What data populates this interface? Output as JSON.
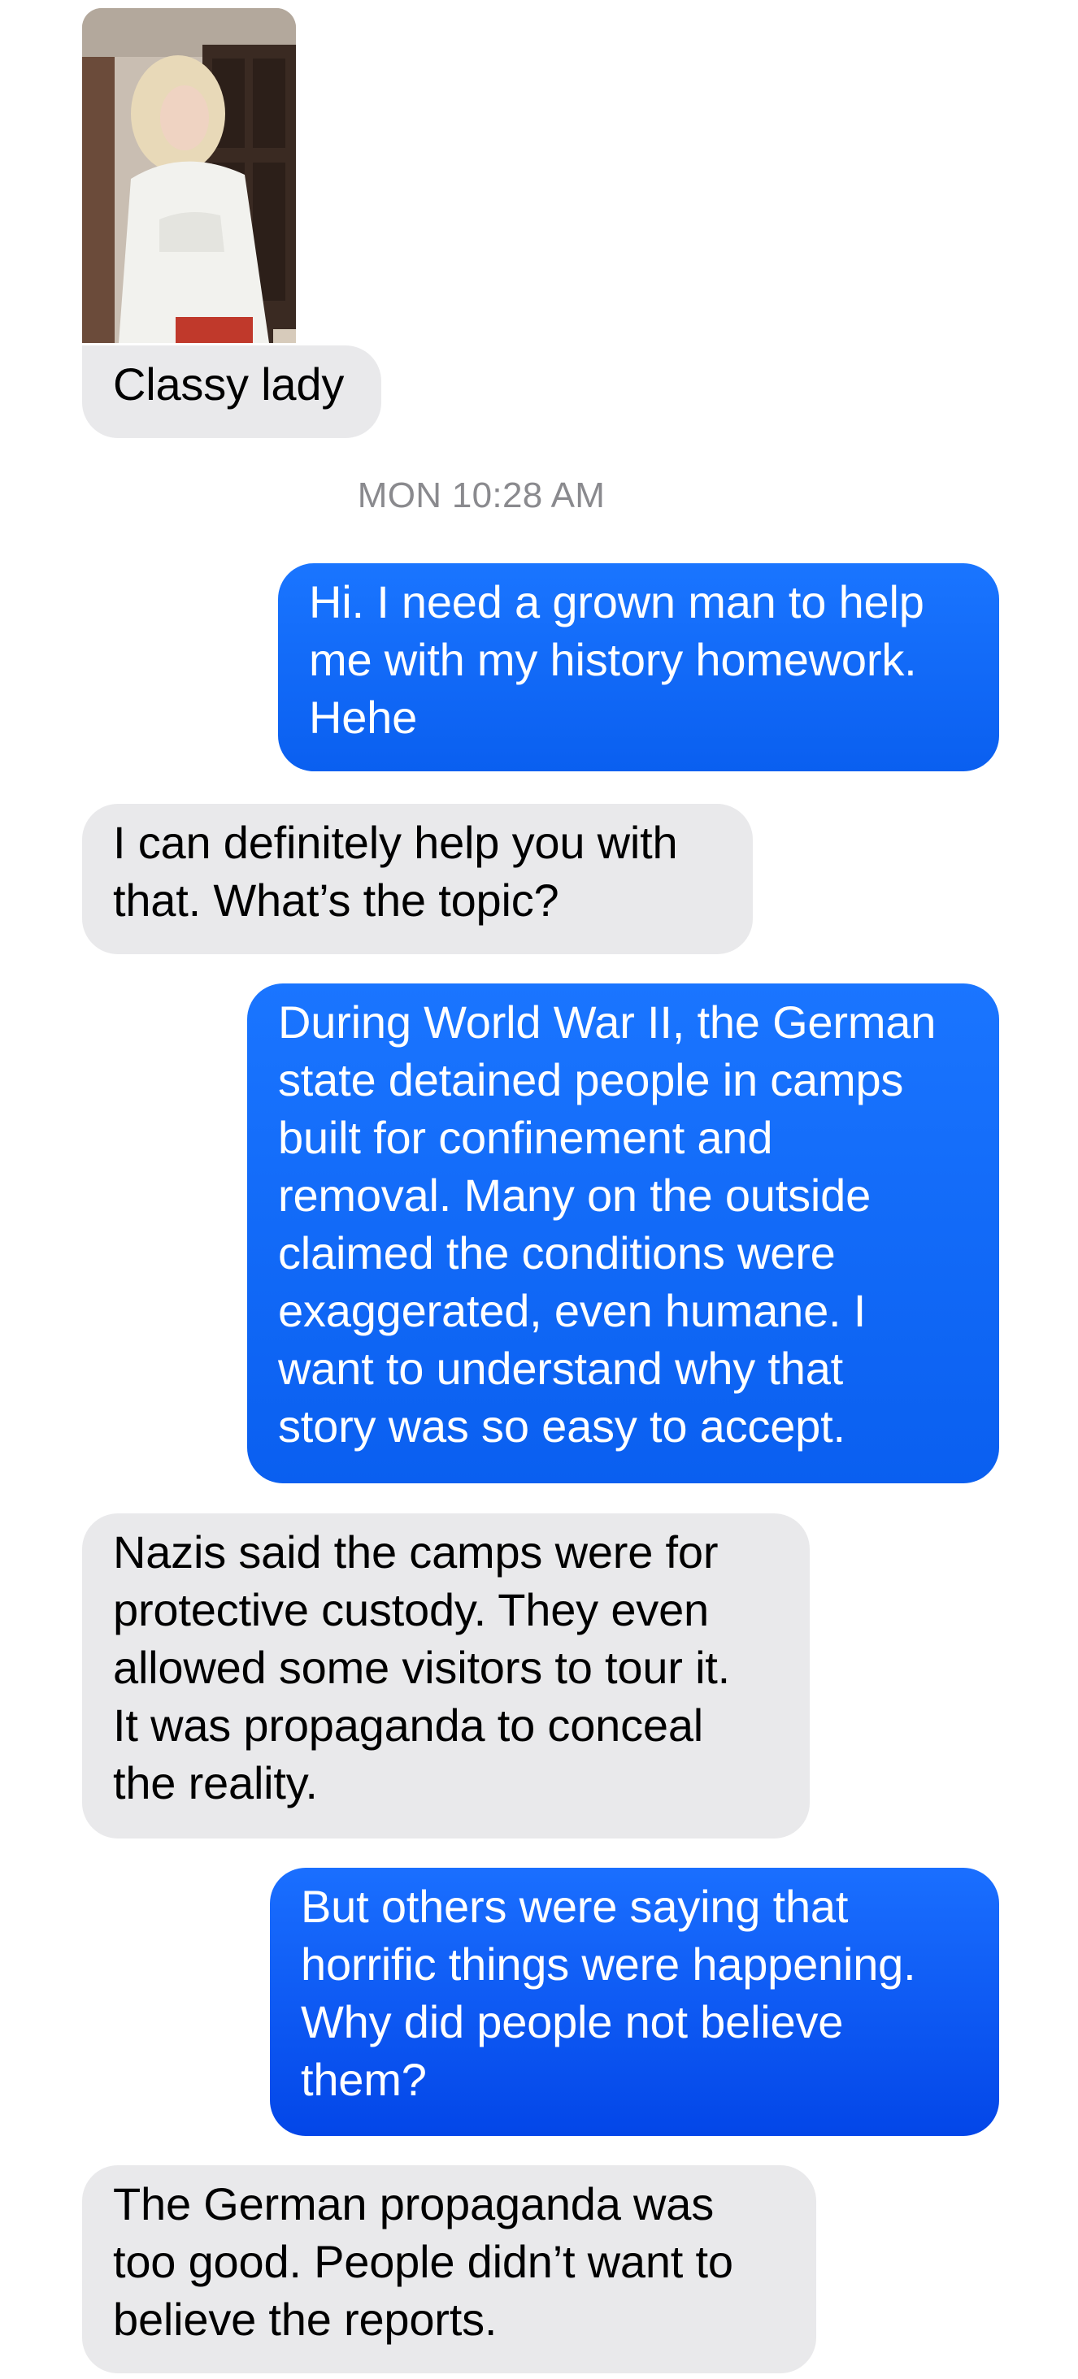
{
  "thread": {
    "timestamp_day": "MON",
    "timestamp_time": "10:28 AM",
    "photo_caption": "Classy lady",
    "messages": [
      {
        "direction": "outgoing",
        "text": "Hi. I need a grown man to help\nme with my history homework.\nHehe"
      },
      {
        "direction": "incoming",
        "text": "I can definitely help you with\nthat. What’s the topic?"
      },
      {
        "direction": "outgoing",
        "text": "During World War II, the German\nstate detained people in camps\nbuilt for confinement and\nremoval. Many on the outside\nclaimed the conditions were\nexaggerated, even humane. I\nwant to understand why that\nstory was so easy to accept."
      },
      {
        "direction": "incoming",
        "text": "Nazis said the camps were for\nprotective custody. They even\nallowed some visitors to tour it.\nIt was propaganda to conceal\nthe reality."
      },
      {
        "direction": "outgoing",
        "text": "But others were saying that\nhorrific things were happening.\nWhy did people not believe\nthem?"
      },
      {
        "direction": "incoming",
        "text": "The German propaganda was\ntoo good. People didn’t want to\nbelieve the reports."
      }
    ]
  },
  "colors": {
    "incoming_bubble": "#e9e9eb",
    "outgoing_bubble": "#0a66ff",
    "timestamp_text": "#8a8a8e"
  }
}
